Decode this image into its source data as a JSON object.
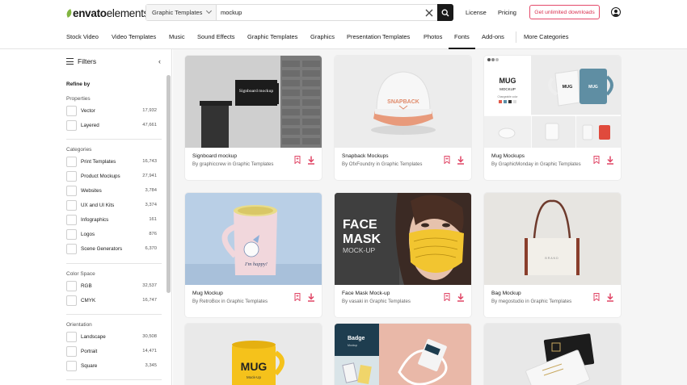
{
  "header": {
    "logo_part1": "envato",
    "logo_part2": "elements",
    "search_category": "Graphic Templates",
    "search_value": "mockup",
    "links": [
      "License",
      "Pricing"
    ],
    "cta": "Get unlimited downloads",
    "accent": "#82b541",
    "cta_color": "#d9304f"
  },
  "catnav": {
    "items": [
      "Stock Video",
      "Video Templates",
      "Music",
      "Sound Effects",
      "Graphic Templates",
      "Graphics",
      "Presentation Templates",
      "Photos",
      "Fonts",
      "Add-ons",
      "More Categories"
    ],
    "active": "Fonts"
  },
  "sidebar": {
    "title": "Filters",
    "refine": "Refine by",
    "sections": [
      {
        "title": "Properties",
        "options": [
          {
            "label": "Vector",
            "count": "17,932"
          },
          {
            "label": "Layered",
            "count": "47,661"
          }
        ]
      },
      {
        "title": "Categories",
        "options": [
          {
            "label": "Print Templates",
            "count": "16,743"
          },
          {
            "label": "Product Mockups",
            "count": "27,941"
          },
          {
            "label": "Websites",
            "count": "3,784"
          },
          {
            "label": "UX and UI Kits",
            "count": "3,374"
          },
          {
            "label": "Infographics",
            "count": "161"
          },
          {
            "label": "Logos",
            "count": "876"
          },
          {
            "label": "Scene Generators",
            "count": "6,370"
          }
        ]
      },
      {
        "title": "Color Space",
        "options": [
          {
            "label": "RGB",
            "count": "32,537"
          },
          {
            "label": "CMYK",
            "count": "16,747"
          }
        ]
      },
      {
        "title": "Orientation",
        "options": [
          {
            "label": "Landscape",
            "count": "30,508"
          },
          {
            "label": "Portrait",
            "count": "14,471"
          },
          {
            "label": "Square",
            "count": "3,345"
          }
        ]
      }
    ]
  },
  "cards": [
    {
      "title": "Signboard mockup",
      "byline": "By graphiccrew in Graphic Templates",
      "thumb_text": "Signboard mockup"
    },
    {
      "title": "Snapback Mockups",
      "byline": "By OfxFoundry in Graphic Templates",
      "thumb_text": "SNAPBACK"
    },
    {
      "title": "Mug Mockups",
      "byline": "By GraphicMonday in Graphic Templates",
      "thumb_text": "MUG",
      "thumb_text2": "MOCKUP",
      "thumb_text3": "Changeable color"
    },
    {
      "title": "Mug Mockup",
      "byline": "By RetroBox in Graphic Templates",
      "thumb_text": "I'm happy!"
    },
    {
      "title": "Face Mask Mock-up",
      "byline": "By vasaki in Graphic Templates",
      "thumb_text": "FACE",
      "thumb_text2": "MASK",
      "thumb_text3": "MOCK-UP"
    },
    {
      "title": "Bag Mockup",
      "byline": "By megostudio in Graphic Templates",
      "thumb_text": "BRAND"
    },
    {
      "title": "",
      "byline": "",
      "thumb_text": "MUG",
      "thumb_text2": "Mock-Up"
    },
    {
      "title": "",
      "byline": "",
      "thumb_text": "Badge",
      "thumb_text2": "Mockup"
    },
    {
      "title": "",
      "byline": "",
      "thumb_text": ""
    }
  ]
}
